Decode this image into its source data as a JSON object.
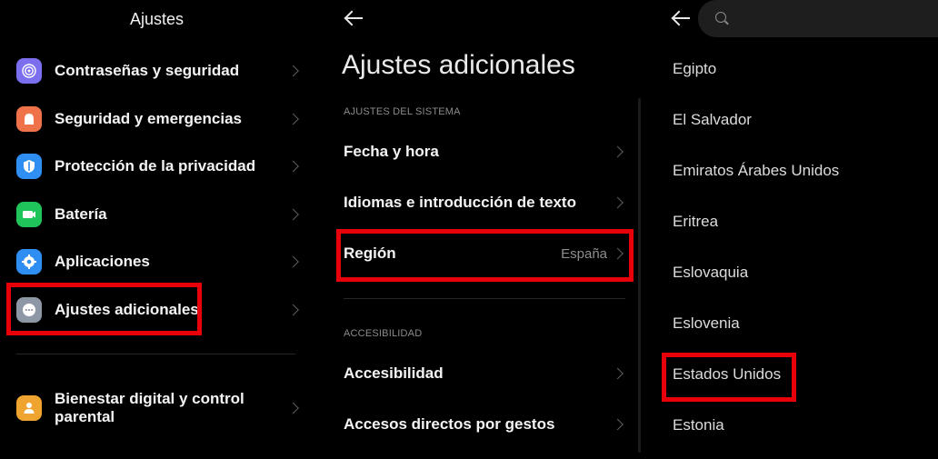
{
  "panel_settings": {
    "title": "Ajustes",
    "items": [
      {
        "label": "Contraseñas y seguridad",
        "icon": "fingerprint-icon",
        "color": "#7b6ff0"
      },
      {
        "label": "Seguridad y emergencias",
        "icon": "emergency-light-icon",
        "color": "#f0724b"
      },
      {
        "label": "Protección de la privacidad",
        "icon": "privacy-shield-icon",
        "color": "#2f8ef2"
      },
      {
        "label": "Batería",
        "icon": "battery-icon",
        "color": "#1fc45a"
      },
      {
        "label": "Aplicaciones",
        "icon": "gear-icon",
        "color": "#2f8ef2"
      },
      {
        "label": "Ajustes adicionales",
        "icon": "more-dots-icon",
        "color": "#8e97a6"
      }
    ],
    "bottom_item": {
      "label_line1": "Bienestar digital y control",
      "label_line2": "parental",
      "icon": "wellbeing-person-icon",
      "color": "#f0a430"
    }
  },
  "panel_additional": {
    "title": "Ajustes adicionales",
    "section_system": "AJUSTES DEL SISTEMA",
    "items_system": [
      {
        "label": "Fecha y hora",
        "value": ""
      },
      {
        "label": "Idiomas e introducción de texto",
        "value": ""
      },
      {
        "label": "Región",
        "value": "España"
      }
    ],
    "section_accessibility": "ACCESIBILIDAD",
    "items_accessibility": [
      {
        "label": "Accesibilidad"
      },
      {
        "label": "Accesos directos por gestos"
      }
    ]
  },
  "panel_region": {
    "search_placeholder": "",
    "countries": [
      "Egipto",
      "El Salvador",
      "Emiratos Árabes Unidos",
      "Eritrea",
      "Eslovaquia",
      "Eslovenia",
      "Estados Unidos",
      "Estonia"
    ]
  },
  "colors": {
    "highlight": "#e8000b",
    "background": "#000000"
  }
}
